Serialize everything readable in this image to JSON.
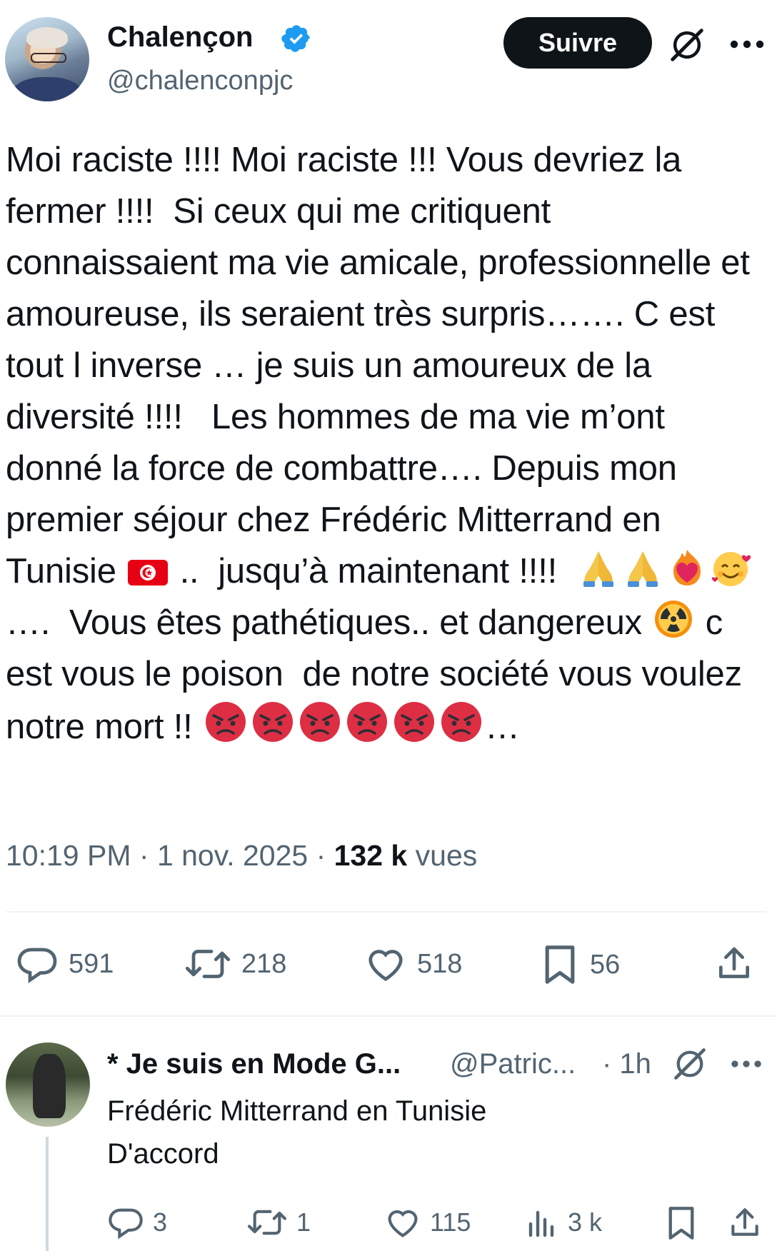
{
  "author": {
    "name": "Chalençon",
    "handle": "@chalenconpjc",
    "follow_label": "Suivre"
  },
  "tweet": {
    "text_parts": [
      "Moi raciste !!!! Moi raciste !!! Vous devriez la fermer !!!!  Si ceux qui me critiquent connaissaient ma vie amicale, professionnelle et amoureuse, ils seraient très surpris……. C est tout l inverse … je suis un amoureux de la diversité !!!!   Les hommes de ma vie m’ont donné la force de combattre…. Depuis mon premier séjour chez Frédéric Mitterrand en Tunisie ",
      " ..  jusqu’à maintenant !!!!  ",
      "….  Vous êtes pathétiques.. et dangereux ",
      " c est vous le poison  de notre société vous voulez notre mort !! ",
      "…"
    ],
    "emoji": {
      "flag": "tunisia-flag-icon",
      "group1": [
        "folded-hands-icon",
        "folded-hands-icon",
        "heart-on-fire-icon",
        "smiling-face-with-hearts-icon"
      ],
      "radioactive": "radioactive-icon",
      "angry_count_label": "six pouting faces"
    },
    "time": "10:19 PM",
    "date": "1 nov. 2025",
    "views_count": "132 k",
    "views_label": "vues"
  },
  "actions": {
    "replies": "591",
    "retweets": "218",
    "likes": "518",
    "bookmarks": "56"
  },
  "reply": {
    "name": "* Je suis en Mode G...",
    "handle": "@Patric...",
    "time": "· 1h",
    "line1": "Frédéric Mitterrand en Tunisie",
    "line2": "D'accord",
    "replies": "3",
    "retweets": "1",
    "likes": "115",
    "views": "3 k"
  },
  "colors": {
    "text": "#0f1419",
    "muted": "#536471",
    "verified": "#1d9bf0",
    "divider": "#eff3f4"
  }
}
